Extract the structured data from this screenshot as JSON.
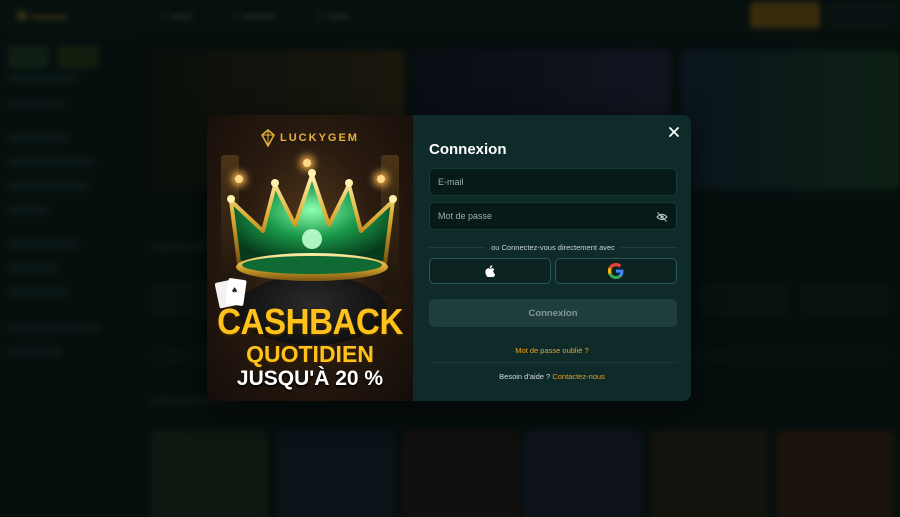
{
  "modal": {
    "title": "Connexion",
    "close_label": "✕",
    "email_placeholder": "E-mail",
    "password_placeholder": "Mot de passe",
    "divider_text": "ou Connectez-vous directement avec",
    "apple_icon": "apple-icon",
    "google_icon": "google-icon",
    "submit_label": "Connexion",
    "forgot_label": "Mot de passe oublié ?",
    "help_text": "Besoin d'aide ?",
    "help_link": "Contactez-nous"
  },
  "promo": {
    "brand": "LUCKYGEM",
    "line1": "CASHBACK",
    "line2": "QUOTIDIEN",
    "line3": "JUSQU'À 20 %"
  },
  "colors": {
    "accent": "#e8a224",
    "panel": "#0e2b2a",
    "field": "#061a18",
    "submit_bg": "#1f3d3a",
    "promo_yellow": "#ffc21a"
  }
}
